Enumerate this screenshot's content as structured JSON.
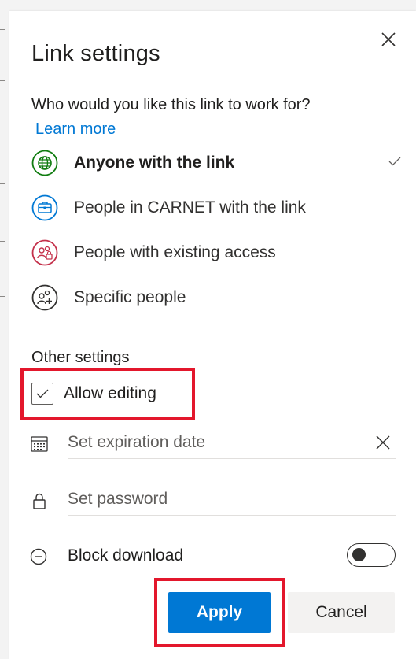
{
  "dialog": {
    "title": "Link settings",
    "close_icon": "close-icon"
  },
  "audience": {
    "question": "Who would you like this link to work for?",
    "learn_more": "Learn more",
    "options": [
      {
        "label": "Anyone with the link",
        "icon": "globe-icon",
        "selected": true,
        "icon_color": "#107c10"
      },
      {
        "label": "People in CARNET with the link",
        "icon": "briefcase-icon",
        "selected": false,
        "icon_color": "#0078d4"
      },
      {
        "label": "People with existing access",
        "icon": "people-lock-icon",
        "selected": false,
        "icon_color": "#c4314b"
      },
      {
        "label": "Specific people",
        "icon": "people-add-icon",
        "selected": false,
        "icon_color": "#323130"
      }
    ],
    "selected_check_icon": "checkmark-icon"
  },
  "other_settings": {
    "heading": "Other settings",
    "allow_editing": {
      "label": "Allow editing",
      "checked": true
    },
    "expiration": {
      "placeholder": "Set expiration date",
      "value": "",
      "icon": "calendar-icon",
      "clear_icon": "close-icon"
    },
    "password": {
      "placeholder": "Set password",
      "value": "",
      "icon": "lock-icon"
    },
    "block_download": {
      "label": "Block download",
      "icon": "block-icon",
      "enabled": false
    }
  },
  "actions": {
    "apply_label": "Apply",
    "cancel_label": "Cancel"
  },
  "colors": {
    "accent": "#0078d4",
    "highlight": "#e3172c"
  }
}
